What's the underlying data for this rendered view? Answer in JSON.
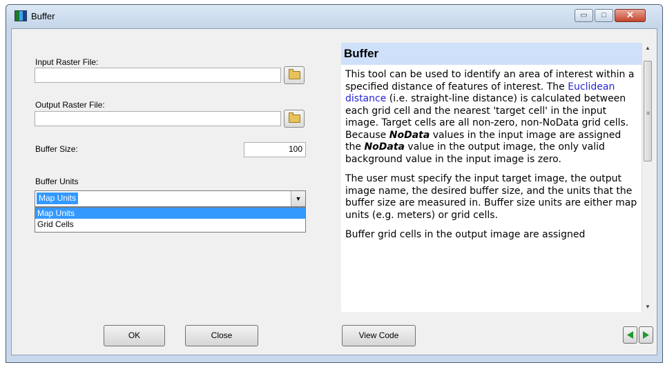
{
  "window": {
    "title": "Buffer",
    "minimize_glyph": "▭",
    "maximize_glyph": "□",
    "close_glyph": "✕"
  },
  "form": {
    "input_label": "Input Raster File:",
    "input_value": "",
    "output_label": "Output Raster File:",
    "output_value": "",
    "buffer_size_label": "Buffer Size:",
    "buffer_size_value": "100",
    "units_label": "Buffer Units",
    "units_selected": "Map Units",
    "units_options": [
      "Map Units",
      "Grid Cells"
    ]
  },
  "buttons": {
    "ok": "OK",
    "close": "Close",
    "view_code": "View Code"
  },
  "help": {
    "title": "Buffer",
    "p1": {
      "a": "This tool can be used to identify an area of interest within a specified distance of features of interest. The ",
      "link": "Euclidean distance",
      "b": " (i.e. straight-line distance) is calculated between each grid cell and the nearest 'target cell' in the input image. Target cells are all non-zero, non-NoData grid cells. Because ",
      "em1": "NoData",
      "c": " values in the input image are assigned the ",
      "em2": "NoData",
      "d": " value in the output image, the only valid background value in the input image is zero."
    },
    "p2": "The user must specify the input target image, the output image name, the desired buffer size, and the units that the buffer size are measured in. Buffer size units are either map units (e.g. meters) or grid cells.",
    "p3": "Buffer grid cells in the output image are assigned"
  },
  "icons": {
    "app": "buffer-app-icon",
    "browse": "folder-open-icon",
    "dropdown": "chevron-down-icon",
    "back": "arrow-left-icon",
    "forward": "arrow-right-icon"
  },
  "colors": {
    "help_header": "#cfe0fa",
    "link": "#2424d8",
    "selection": "#3399ff",
    "nav_arrow": "#1f9a2f"
  }
}
